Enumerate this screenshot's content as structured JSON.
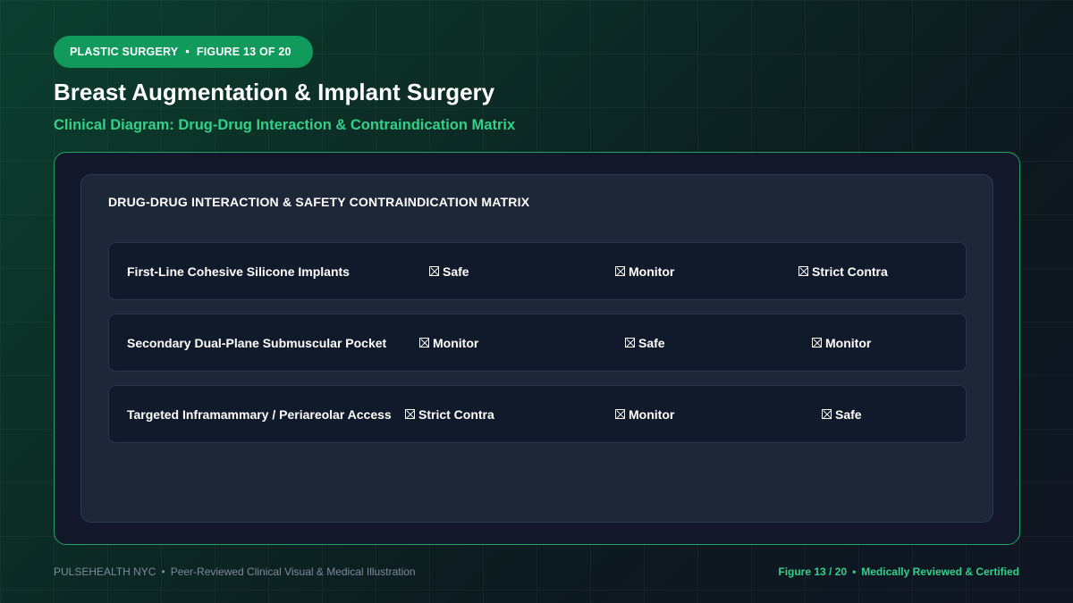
{
  "badge": {
    "category": "PLASTIC SURGERY",
    "separator": "•",
    "figure": "FIGURE 13 OF 20"
  },
  "header": {
    "title": "Breast Augmentation & Implant Surgery",
    "subtitle": "Clinical Diagram: Drug-Drug Interaction & Contraindication Matrix"
  },
  "matrix": {
    "title": "DRUG-DRUG INTERACTION & SAFETY CONTRAINDICATION MATRIX",
    "rows": [
      {
        "label": "First-Line Cohesive Silicone Implants",
        "cells": [
          "Safe",
          "Monitor",
          "Strict Contra"
        ]
      },
      {
        "label": "Secondary Dual-Plane Submuscular Pocket",
        "cells": [
          "Monitor",
          "Safe",
          "Monitor"
        ]
      },
      {
        "label": "Targeted Inframammary / Periareolar Access",
        "cells": [
          "Strict Contra",
          "Monitor",
          "Safe"
        ]
      }
    ]
  },
  "icons": {
    "cell_marker": "boxed-x-icon"
  },
  "footer": {
    "brand": "PULSEHEALTH NYC",
    "separator": "•",
    "tagline": "Peer-Reviewed Clinical Visual & Medical Illustration",
    "figure": "Figure 13 / 20",
    "certification": "Medically Reviewed & Certified"
  },
  "colors": {
    "accent": "#34d08a",
    "badge": "#129a5c",
    "panel_border": "#22a366"
  }
}
